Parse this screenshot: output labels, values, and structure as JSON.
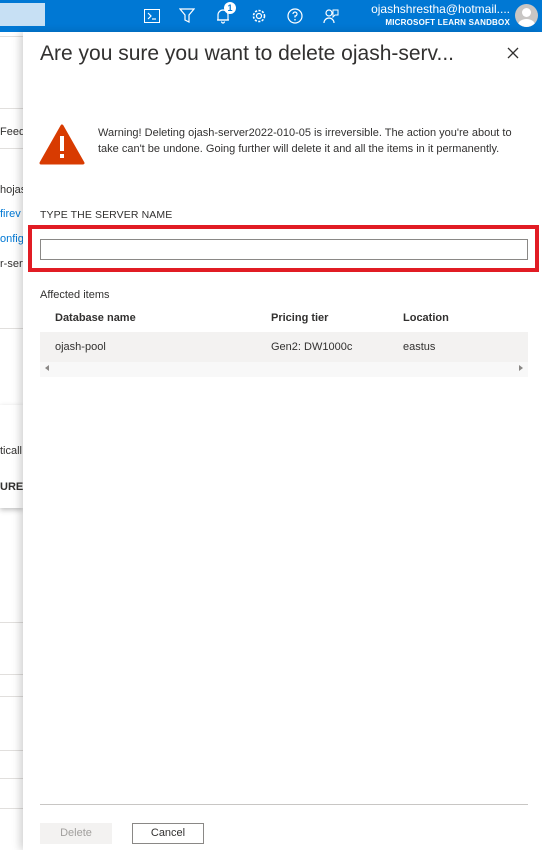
{
  "topbar": {
    "notification_count": "1",
    "account_email": "ojashshrestha@hotmail....",
    "account_directory": "MICROSOFT LEARN SANDBOX",
    "icons": [
      "cloud-shell-icon",
      "directory-filter-icon",
      "notifications-icon",
      "settings-icon",
      "help-icon",
      "feedback-icon"
    ]
  },
  "background": {
    "fragments": [
      "Feed",
      "hojas",
      "firev",
      "onfig",
      "r-serv",
      "ticall",
      "URE"
    ]
  },
  "dialog": {
    "title": "Are you sure you want to delete ojash-serv...",
    "warning": "Warning! Deleting ojash-server2022-010-05 is irreversible. The action you're about to take can't be undone. Going further will delete it and all the items in it permanently.",
    "field_label": "TYPE THE SERVER NAME",
    "field_value": "",
    "field_placeholder": "",
    "affected_label": "Affected items",
    "columns": [
      "Database name",
      "Pricing tier",
      "Location"
    ],
    "rows": [
      [
        "ojash-pool",
        "Gen2: DW1000c",
        "eastus"
      ]
    ],
    "delete_label": "Delete",
    "cancel_label": "Cancel"
  },
  "colors": {
    "brand": "#0078d4",
    "warning": "#d83b01",
    "highlight": "#e11c24",
    "link": "#0078d4"
  }
}
